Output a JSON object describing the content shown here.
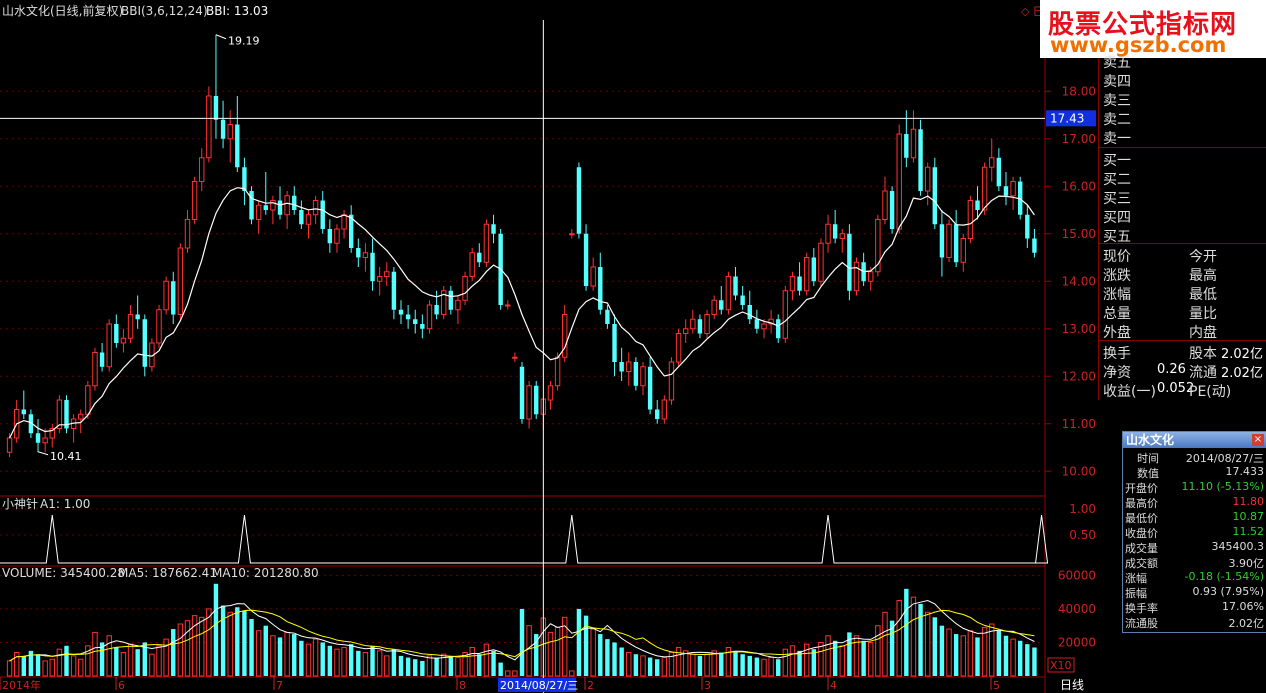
{
  "header": {
    "stock_title": "山水文化(日线,前复权)",
    "bbi_label": "BBI(3,6,12,24)",
    "bbi_value": "BBI: 13.03",
    "peak_label": "19.19",
    "trough_label": "10.41",
    "cross_price": "17.43",
    "right_marker": "◇ 巳"
  },
  "indicator": {
    "title": "小神针",
    "a1_label": "A1: 1.00",
    "ticks": [
      "1.00",
      "0.50"
    ]
  },
  "volume": {
    "label": "VOLUME: 345400.28",
    "ma5": "MA5: 187662.41",
    "ma10": "MA10: 201280.80",
    "ticks": [
      "60000",
      "40000",
      "20000"
    ],
    "unit": "X10"
  },
  "x_axis": {
    "labels": [
      "2014年",
      "6",
      "7",
      "8",
      "2014/08/27/三",
      "2",
      "3",
      "4",
      "5"
    ],
    "period": "日线"
  },
  "price_axis": [
    "18.00",
    "17.00",
    "16.00",
    "15.00",
    "14.00",
    "13.00",
    "12.00",
    "11.00",
    "10.00"
  ],
  "logo": {
    "line1": "股票公式指标网",
    "line2": "www.gszb.com"
  },
  "quote_panel": {
    "sell": [
      "卖五",
      "卖四",
      "卖三",
      "卖二",
      "卖一"
    ],
    "buy": [
      "买一",
      "买二",
      "买三",
      "买四",
      "买五"
    ],
    "left_labels": [
      "现价",
      "涨跌",
      "涨幅",
      "总量",
      "外盘"
    ],
    "right_labels": [
      "今开",
      "最高",
      "最低",
      "量比",
      "内盘"
    ],
    "huanshou": "换手",
    "guben": "股本",
    "guben_val": "2.02亿",
    "jingzi": "净资",
    "jingzi_val": "0.26",
    "liutong": "流通",
    "liutong_val": "2.02亿",
    "shouyi": "收益(一)",
    "shouyi_val": "0.052",
    "pe": "PE(动)"
  },
  "popup": {
    "title": "山水文化",
    "close": "×",
    "rows": [
      {
        "k": "时间",
        "v": "2014/08/27/三",
        "c": "#ddd"
      },
      {
        "k": "数值",
        "v": "17.433",
        "c": "#ddd"
      },
      {
        "k": "开盘价",
        "v": "11.10 (-5.13%)",
        "c": "#3c3"
      },
      {
        "k": "最高价",
        "v": "11.80",
        "c": "#e33"
      },
      {
        "k": "最低价",
        "v": "10.87",
        "c": "#3c3"
      },
      {
        "k": "收盘价",
        "v": "11.52",
        "c": "#3c3"
      },
      {
        "k": "成交量",
        "v": "345400.3",
        "c": "#ddd"
      },
      {
        "k": "成交额",
        "v": "3.90亿",
        "c": "#ddd"
      },
      {
        "k": "涨幅",
        "v": "-0.18 (-1.54%)",
        "c": "#3c3"
      },
      {
        "k": "振幅",
        "v": "0.93 (7.95%)",
        "c": "#ddd"
      },
      {
        "k": "换手率",
        "v": "17.06%",
        "c": "#ddd"
      },
      {
        "k": "流通股",
        "v": "2.02亿",
        "c": "#ddd"
      }
    ]
  },
  "chart_data": {
    "type": "candlestick",
    "price_range": [
      9.5,
      19.5
    ],
    "volume_range": [
      0,
      65000
    ],
    "candles": [
      [
        10.4,
        10.8,
        10.3,
        10.7,
        9000
      ],
      [
        10.7,
        11.5,
        10.6,
        11.3,
        14000
      ],
      [
        11.3,
        11.7,
        11.1,
        11.2,
        12000
      ],
      [
        11.2,
        11.3,
        10.7,
        10.8,
        15000
      ],
      [
        10.8,
        11.1,
        10.4,
        10.6,
        13000
      ],
      [
        10.6,
        10.9,
        10.4,
        10.7,
        9000
      ],
      [
        10.7,
        11.0,
        10.5,
        10.9,
        10000
      ],
      [
        10.9,
        11.6,
        10.8,
        11.5,
        16000
      ],
      [
        11.5,
        11.6,
        10.8,
        10.9,
        18000
      ],
      [
        10.9,
        11.2,
        10.6,
        11.1,
        12000
      ],
      [
        11.1,
        11.3,
        10.8,
        11.2,
        10000
      ],
      [
        11.2,
        11.9,
        11.1,
        11.8,
        18000
      ],
      [
        11.8,
        12.6,
        11.7,
        12.5,
        26000
      ],
      [
        12.5,
        12.7,
        12.1,
        12.2,
        20000
      ],
      [
        12.2,
        13.2,
        12.1,
        13.1,
        24000
      ],
      [
        13.1,
        13.3,
        12.6,
        12.7,
        17000
      ],
      [
        12.7,
        13.0,
        12.5,
        12.8,
        14000
      ],
      [
        12.8,
        13.5,
        12.7,
        13.3,
        19000
      ],
      [
        13.3,
        13.7,
        13.0,
        13.2,
        16000
      ],
      [
        13.2,
        13.3,
        12.0,
        12.2,
        20000
      ],
      [
        12.2,
        12.8,
        12.1,
        12.7,
        13000
      ],
      [
        12.7,
        13.5,
        12.6,
        13.4,
        18000
      ],
      [
        13.4,
        14.1,
        13.3,
        14.0,
        22000
      ],
      [
        14.0,
        14.2,
        13.1,
        13.3,
        28000
      ],
      [
        13.3,
        14.8,
        13.2,
        14.7,
        31000
      ],
      [
        14.7,
        15.5,
        14.6,
        15.3,
        33000
      ],
      [
        15.3,
        16.2,
        15.2,
        16.1,
        36000
      ],
      [
        16.1,
        16.8,
        15.9,
        16.6,
        35000
      ],
      [
        16.6,
        18.1,
        16.5,
        17.9,
        40000
      ],
      [
        17.9,
        19.19,
        17.0,
        17.4,
        55000
      ],
      [
        17.4,
        17.8,
        16.8,
        17.0,
        42000
      ],
      [
        17.0,
        17.6,
        16.5,
        17.3,
        38000
      ],
      [
        17.3,
        17.9,
        16.3,
        16.4,
        41000
      ],
      [
        16.4,
        16.6,
        15.6,
        15.9,
        39000
      ],
      [
        15.9,
        16.0,
        15.2,
        15.3,
        34000
      ],
      [
        15.3,
        15.7,
        15.0,
        15.6,
        27000
      ],
      [
        15.6,
        16.3,
        15.4,
        15.5,
        30000
      ],
      [
        15.5,
        15.8,
        15.2,
        15.7,
        24000
      ],
      [
        15.7,
        16.0,
        15.3,
        15.4,
        23000
      ],
      [
        15.4,
        15.9,
        15.1,
        15.8,
        26000
      ],
      [
        15.8,
        16.0,
        15.4,
        15.5,
        25000
      ],
      [
        15.5,
        15.7,
        15.1,
        15.2,
        21000
      ],
      [
        15.2,
        15.5,
        14.9,
        15.4,
        19000
      ],
      [
        15.4,
        15.8,
        15.2,
        15.7,
        22000
      ],
      [
        15.7,
        15.9,
        15.0,
        15.1,
        20000
      ],
      [
        15.1,
        15.3,
        14.6,
        14.8,
        18000
      ],
      [
        14.8,
        15.2,
        14.6,
        15.1,
        16000
      ],
      [
        15.1,
        15.5,
        14.9,
        15.4,
        17000
      ],
      [
        15.4,
        15.6,
        14.6,
        14.7,
        19000
      ],
      [
        14.7,
        14.9,
        14.3,
        14.5,
        15000
      ],
      [
        14.5,
        14.8,
        14.2,
        14.6,
        14000
      ],
      [
        14.6,
        14.9,
        13.8,
        14.0,
        18000
      ],
      [
        14.0,
        14.3,
        13.7,
        14.1,
        15000
      ],
      [
        14.1,
        14.4,
        13.9,
        14.2,
        12000
      ],
      [
        14.2,
        14.3,
        13.2,
        13.4,
        16000
      ],
      [
        13.4,
        13.6,
        13.1,
        13.3,
        12000
      ],
      [
        13.3,
        13.5,
        13.0,
        13.2,
        11000
      ],
      [
        13.2,
        13.4,
        12.9,
        13.1,
        10000
      ],
      [
        13.1,
        13.3,
        12.8,
        13.0,
        9000
      ],
      [
        13.0,
        13.6,
        12.9,
        13.5,
        12000
      ],
      [
        13.5,
        13.8,
        13.2,
        13.3,
        11000
      ],
      [
        13.3,
        13.9,
        13.2,
        13.8,
        13000
      ],
      [
        13.8,
        13.9,
        13.3,
        13.4,
        12000
      ],
      [
        13.4,
        13.7,
        13.1,
        13.6,
        11000
      ],
      [
        13.6,
        14.2,
        13.5,
        14.1,
        14000
      ],
      [
        14.1,
        14.7,
        14.0,
        14.6,
        17000
      ],
      [
        14.6,
        14.8,
        14.3,
        14.4,
        13000
      ],
      [
        14.4,
        15.3,
        14.3,
        15.2,
        19000
      ],
      [
        15.2,
        15.4,
        14.8,
        15.0,
        15000
      ],
      [
        15.0,
        15.1,
        13.4,
        13.5,
        8000
      ],
      [
        13.5,
        13.6,
        13.4,
        13.5,
        3000
      ],
      [
        12.4,
        12.5,
        12.3,
        12.4,
        3000
      ],
      [
        12.2,
        12.3,
        11.0,
        11.1,
        40000
      ],
      [
        11.1,
        11.9,
        10.9,
        11.8,
        30000
      ],
      [
        11.8,
        11.9,
        11.1,
        11.2,
        25000
      ],
      [
        11.2,
        11.5,
        10.87,
        11.52,
        34540
      ],
      [
        11.5,
        11.9,
        11.3,
        11.8,
        26000
      ],
      [
        11.8,
        12.5,
        11.7,
        12.4,
        29000
      ],
      [
        12.4,
        13.5,
        12.3,
        13.3,
        35000
      ],
      [
        15.0,
        15.1,
        14.9,
        15.0,
        3000
      ],
      [
        16.4,
        16.5,
        14.9,
        15.0,
        40000
      ],
      [
        15.0,
        15.2,
        13.8,
        13.9,
        36000
      ],
      [
        13.9,
        14.5,
        13.8,
        14.3,
        28000
      ],
      [
        14.3,
        14.6,
        13.3,
        13.4,
        25000
      ],
      [
        13.4,
        13.5,
        13.0,
        13.1,
        22000
      ],
      [
        13.1,
        13.3,
        12.0,
        12.3,
        20000
      ],
      [
        12.3,
        12.6,
        11.9,
        12.1,
        17000
      ],
      [
        12.1,
        12.5,
        11.8,
        12.3,
        14000
      ],
      [
        12.3,
        12.4,
        11.7,
        11.8,
        13000
      ],
      [
        11.8,
        12.3,
        11.6,
        12.2,
        12000
      ],
      [
        12.2,
        12.4,
        11.2,
        11.3,
        11000
      ],
      [
        11.3,
        11.5,
        11.0,
        11.1,
        10000
      ],
      [
        11.1,
        11.6,
        11.0,
        11.5,
        11000
      ],
      [
        11.5,
        12.4,
        11.4,
        12.3,
        14000
      ],
      [
        12.3,
        13.0,
        12.2,
        12.9,
        17000
      ],
      [
        12.9,
        13.2,
        12.7,
        13.0,
        15000
      ],
      [
        13.0,
        13.4,
        12.9,
        13.2,
        13000
      ],
      [
        13.2,
        13.3,
        12.8,
        12.9,
        12000
      ],
      [
        12.9,
        13.4,
        12.8,
        13.3,
        13000
      ],
      [
        13.3,
        13.7,
        13.2,
        13.6,
        15000
      ],
      [
        13.6,
        13.9,
        13.3,
        13.4,
        14000
      ],
      [
        13.4,
        14.2,
        13.3,
        14.1,
        17000
      ],
      [
        14.1,
        14.3,
        13.6,
        13.7,
        15000
      ],
      [
        13.7,
        13.9,
        13.4,
        13.5,
        13000
      ],
      [
        13.5,
        13.8,
        13.1,
        13.2,
        12000
      ],
      [
        13.2,
        13.4,
        12.9,
        13.0,
        11000
      ],
      [
        13.0,
        13.2,
        12.8,
        13.1,
        10000
      ],
      [
        13.1,
        13.4,
        12.9,
        13.2,
        11000
      ],
      [
        13.2,
        13.3,
        12.7,
        12.8,
        10000
      ],
      [
        12.8,
        13.9,
        12.7,
        13.8,
        16000
      ],
      [
        13.8,
        14.2,
        13.6,
        14.1,
        18000
      ],
      [
        14.1,
        14.4,
        13.7,
        13.8,
        15000
      ],
      [
        13.8,
        14.6,
        13.7,
        14.5,
        19000
      ],
      [
        14.5,
        14.7,
        13.9,
        14.0,
        16000
      ],
      [
        14.0,
        14.9,
        13.9,
        14.8,
        20000
      ],
      [
        14.8,
        15.4,
        14.6,
        15.2,
        24000
      ],
      [
        15.2,
        15.5,
        14.8,
        14.9,
        21000
      ],
      [
        14.9,
        15.1,
        14.6,
        15.0,
        18000
      ],
      [
        15.0,
        15.2,
        13.6,
        13.8,
        26000
      ],
      [
        13.8,
        14.5,
        13.7,
        14.4,
        24000
      ],
      [
        14.4,
        14.6,
        13.9,
        14.0,
        21000
      ],
      [
        14.0,
        14.3,
        13.8,
        14.2,
        20000
      ],
      [
        14.2,
        15.4,
        14.1,
        15.3,
        30000
      ],
      [
        15.3,
        16.2,
        15.2,
        15.9,
        38000
      ],
      [
        15.9,
        16.0,
        15.0,
        15.1,
        33000
      ],
      [
        15.1,
        17.3,
        15.0,
        17.1,
        45000
      ],
      [
        17.1,
        17.6,
        16.4,
        16.6,
        52000
      ],
      [
        16.6,
        17.6,
        16.5,
        17.2,
        47000
      ],
      [
        17.2,
        17.4,
        15.8,
        15.9,
        43000
      ],
      [
        15.9,
        16.5,
        15.6,
        16.4,
        38000
      ],
      [
        16.4,
        16.6,
        15.1,
        15.2,
        35000
      ],
      [
        15.2,
        15.5,
        14.1,
        14.5,
        30000
      ],
      [
        14.5,
        15.3,
        14.4,
        15.2,
        28000
      ],
      [
        15.2,
        15.5,
        14.3,
        14.4,
        25000
      ],
      [
        14.4,
        15.0,
        14.2,
        14.9,
        24000
      ],
      [
        14.9,
        15.8,
        14.8,
        15.7,
        27000
      ],
      [
        15.7,
        16.0,
        15.3,
        15.5,
        23000
      ],
      [
        15.5,
        16.5,
        15.4,
        16.4,
        29000
      ],
      [
        16.4,
        17.0,
        16.1,
        16.6,
        31000
      ],
      [
        16.6,
        16.8,
        15.9,
        16.0,
        27000
      ],
      [
        16.0,
        16.3,
        15.6,
        15.8,
        24000
      ],
      [
        15.8,
        16.2,
        15.5,
        16.1,
        22000
      ],
      [
        16.1,
        16.2,
        15.3,
        15.4,
        21000
      ],
      [
        15.4,
        15.6,
        14.7,
        14.9,
        19000
      ],
      [
        14.9,
        15.1,
        14.5,
        14.6,
        17000
      ]
    ],
    "signals": [
      6,
      33,
      79,
      115,
      145
    ]
  }
}
